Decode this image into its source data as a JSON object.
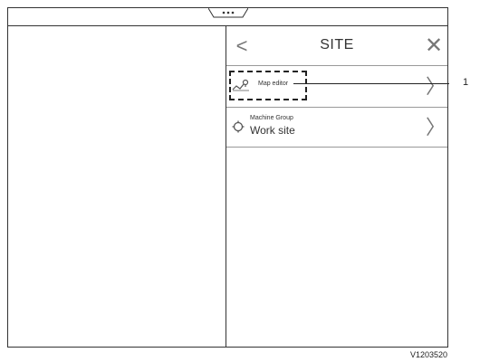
{
  "panel": {
    "back_glyph": "<",
    "title": "SITE",
    "close_glyph": "✕",
    "chevron_glyph": "〉"
  },
  "items": [
    {
      "icon": "map-editor-icon",
      "label": "Map editor"
    },
    {
      "icon": "machine-group-icon",
      "label": "Machine Group",
      "value": "Work site"
    }
  ],
  "callout": {
    "number": "1"
  },
  "figure_code": "V1203520"
}
